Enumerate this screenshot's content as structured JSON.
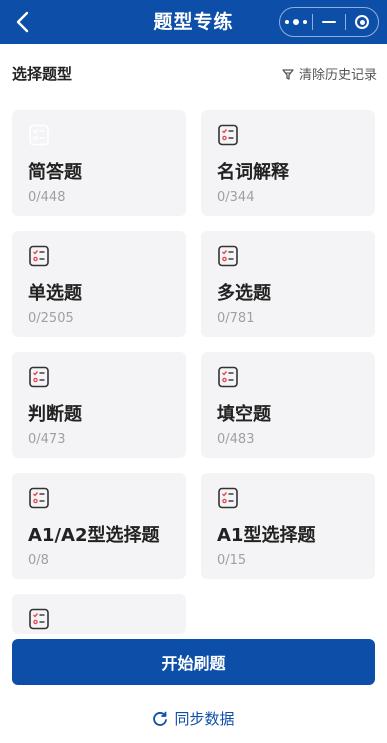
{
  "header": {
    "title": "题型专练",
    "colors": {
      "bar": "#0d4fa8"
    }
  },
  "section": {
    "label": "选择题型",
    "clear_label": "清除历史记录"
  },
  "cards": [
    {
      "name": "简答题",
      "count": "0/448",
      "active": true
    },
    {
      "name": "名词解释",
      "count": "0/344",
      "active": false
    },
    {
      "name": "单选题",
      "count": "0/2505",
      "active": false
    },
    {
      "name": "多选题",
      "count": "0/781",
      "active": false
    },
    {
      "name": "判断题",
      "count": "0/473",
      "active": false
    },
    {
      "name": "填空题",
      "count": "0/483",
      "active": false
    },
    {
      "name": "A1/A2型选择题",
      "count": "0/8",
      "active": false
    },
    {
      "name": "A1型选择题",
      "count": "0/15",
      "active": false
    },
    {
      "name": "",
      "count": "",
      "active": false
    }
  ],
  "footer": {
    "start_label": "开始刷题",
    "sync_label": "同步数据"
  },
  "icons": {
    "back": "back-arrow-icon",
    "more": "more-dots-icon",
    "minimize": "minimize-icon",
    "close": "close-target-icon",
    "clear": "clear-history-icon",
    "card": "checklist-icon",
    "sync": "refresh-icon"
  }
}
